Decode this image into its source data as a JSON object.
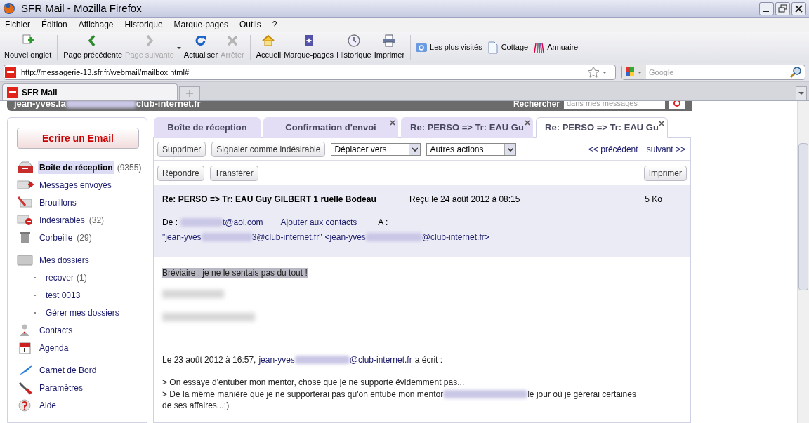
{
  "window": {
    "title": "SFR Mail - Mozilla Firefox"
  },
  "menu": [
    "Fichier",
    "Édition",
    "Affichage",
    "Historique",
    "Marque-pages",
    "Outils",
    "?"
  ],
  "toolbar": [
    {
      "label": "Nouvel onglet",
      "disabled": false
    },
    {
      "label": "Page précédente",
      "disabled": false
    },
    {
      "label": "Page suivante",
      "disabled": true
    },
    {
      "label": "Actualiser",
      "disabled": false
    },
    {
      "label": "Arrêter",
      "disabled": true
    },
    {
      "label": "Accueil",
      "disabled": false
    },
    {
      "label": "Marque-pages",
      "disabled": false
    },
    {
      "label": "Historique",
      "disabled": false
    },
    {
      "label": "Imprimer",
      "disabled": false
    }
  ],
  "bookmarks": [
    "Les plus visités",
    "Cottage",
    "Annuaire"
  ],
  "address": {
    "value": "http://messagerie-13.sfr.fr/webmail/mailbox.html#"
  },
  "search": {
    "placeholder": "Google"
  },
  "browser_tabs": [
    {
      "label": "SFR Mail",
      "selected": true
    }
  ],
  "header": {
    "account_start": "jean-yves.la",
    "account_end": "club-internet.fr",
    "search_label": "Rechercher",
    "search_placeholder": "dans mes messages"
  },
  "compose_button": "Ecrire un Email",
  "sidebar": [
    {
      "kind": "item",
      "label": "Boîte de réception",
      "count": "(9355)",
      "selected": true
    },
    {
      "kind": "item",
      "label": "Messages envoyés",
      "selected": false
    },
    {
      "kind": "item",
      "label": "Brouillons",
      "selected": false
    },
    {
      "kind": "item",
      "label": "Indésirables",
      "count": "(32)",
      "selected": false
    },
    {
      "kind": "item",
      "label": "Corbeille",
      "count": "(29)",
      "selected": false
    },
    {
      "kind": "item",
      "label": "Mes dossiers",
      "selected": false,
      "children": [
        {
          "label": "recover",
          "count": "(1)",
          "selected": false
        },
        {
          "label": "test 0013",
          "selected": false
        },
        {
          "label": "Gérer mes dossiers",
          "selected": false
        }
      ]
    },
    {
      "kind": "item",
      "label": "Contacts",
      "selected": false
    },
    {
      "kind": "item",
      "label": "Agenda",
      "selected": false
    },
    {
      "kind": "item",
      "label": "Carnet de Bord",
      "selected": false
    },
    {
      "kind": "item",
      "label": "Paramètres",
      "selected": false
    },
    {
      "kind": "item",
      "label": "Aide",
      "selected": false
    }
  ],
  "mail_tabs": [
    {
      "label": "Boîte de réception",
      "selected": false,
      "closable": false
    },
    {
      "label": "Confirmation d'envoi",
      "selected": false,
      "closable": true
    },
    {
      "label": "Re: PERSO => Tr: EAU Gu",
      "selected": false,
      "closable": true
    },
    {
      "label": "Re: PERSO => Tr: EAU Gu",
      "selected": true,
      "closable": true
    }
  ],
  "actions": {
    "buttons": [
      "Supprimer",
      "Signaler comme indésirable"
    ],
    "selects": [
      "Déplacer vers",
      "Autres actions"
    ],
    "prev": "<< précédent",
    "next": "suivant >>",
    "reply": [
      "Répondre",
      "Transférer"
    ],
    "print": "Imprimer"
  },
  "message": {
    "subject": "Re: PERSO => Tr: EAU Guy GILBERT 1 ruelle Bodeau",
    "received": "Reçu le 24 août 2012 à 08:15",
    "size": "5 Ko",
    "from_label": "De :",
    "from_end": "t@aol.com",
    "add_contact": "Ajouter aux contacts",
    "to_label": "A :",
    "to_1_start": "\"jean-yves",
    "to_1_end": "3@club-internet.fr\"",
    "to_2_start": "<jean-yves",
    "to_2_end": "@club-internet.fr>",
    "highlight": "Bréviaire : je ne le sentais pas du tout !",
    "quote_intro": "Le 23 août 2012 à 16:57,",
    "quote_link_start": "jean-yves",
    "quote_link_end": "@club-internet.fr",
    "quote_wrote": "a écrit :",
    "quote_1": "> On essaye d'entuber mon mentor, chose que je ne supporte évidemment pas...",
    "quote_2_start": "> De la même manière que je ne supporterai pas qu'on entube mon mentor",
    "quote_2_end": "le jour où je gèrerai certaines",
    "quote_3": "de ses affaires...;)"
  }
}
